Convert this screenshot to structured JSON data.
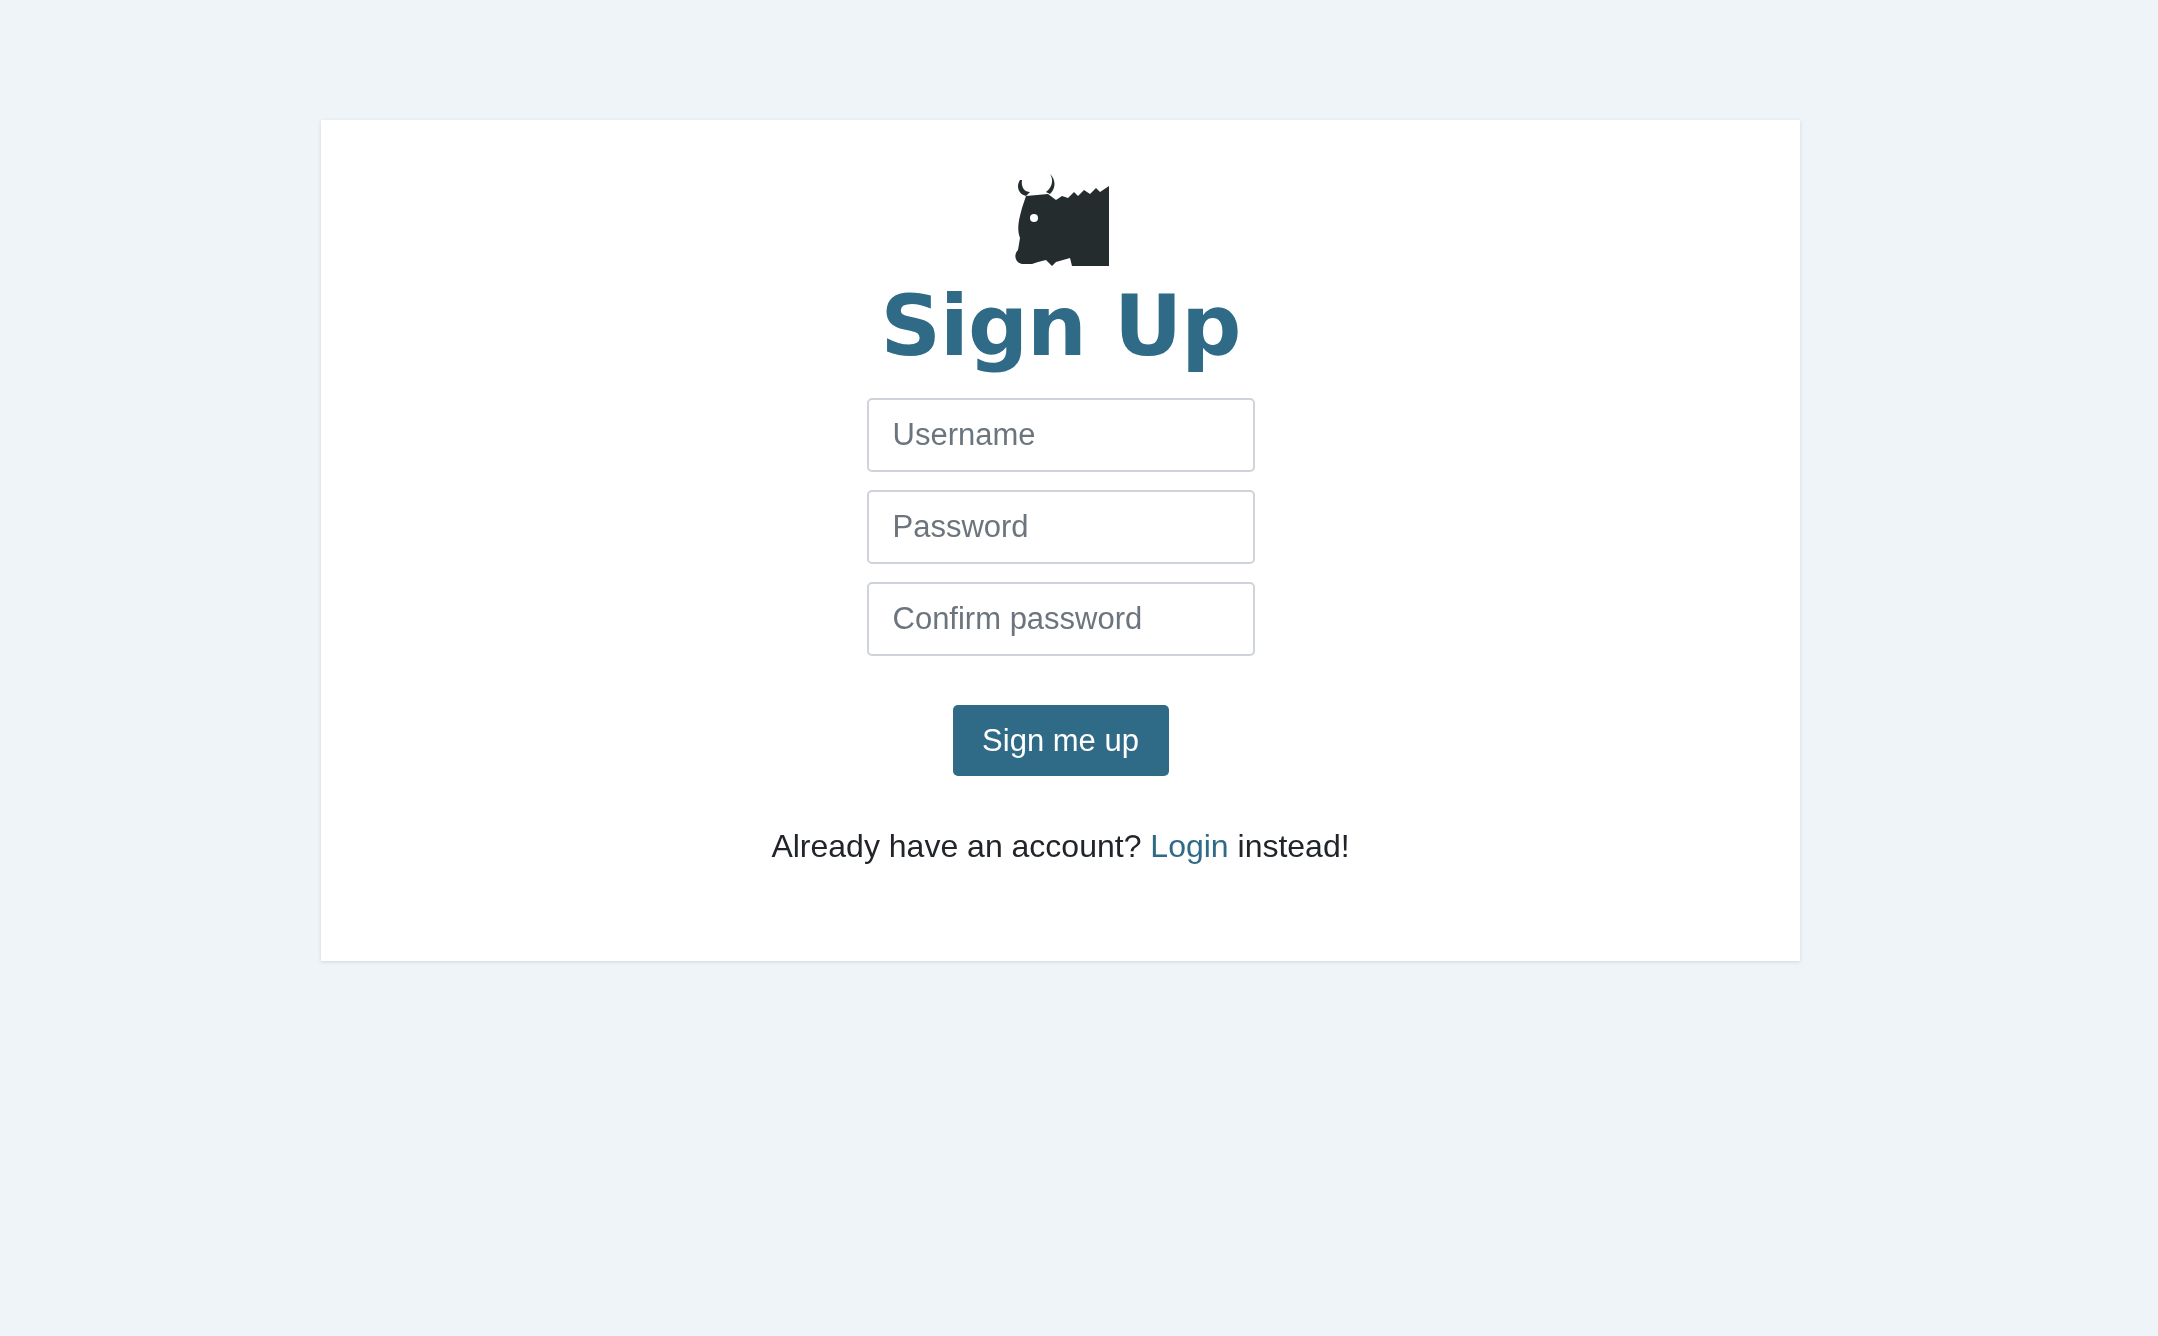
{
  "title": "Sign Up",
  "fields": [
    {
      "placeholder": "Username"
    },
    {
      "placeholder": "Password"
    },
    {
      "placeholder": "Confirm password"
    }
  ],
  "button": "Sign me up",
  "footer": {
    "before": "Already have an account?",
    "link": "Login",
    "after": "instead!"
  }
}
